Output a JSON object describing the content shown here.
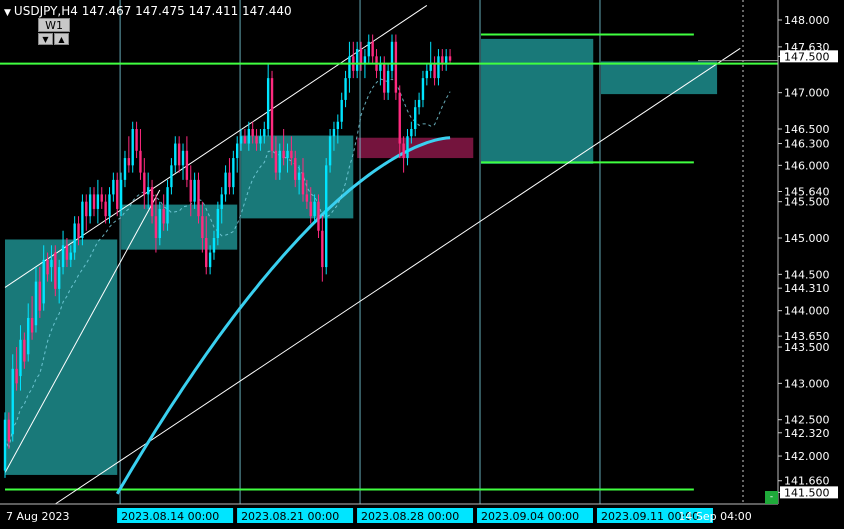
{
  "header": {
    "symbol": "USDJPY,H4",
    "ohlc": "147.467 147.475 147.411 147.440",
    "timeframe_label": "W1",
    "btn_down": "▼",
    "btn_up": "▲",
    "corner_btn": "-"
  },
  "colors": {
    "background": "#000000",
    "bull": "#00e5ff",
    "bear": "#ff2a7f",
    "zone_teal": "#1a7f7f",
    "zone_maroon": "#7a1540",
    "ma_thick": "#3ad0f0",
    "level_green": "#40ff40",
    "current_line": "#40ff40",
    "vgrid": "#7fd6e6"
  },
  "chart_data": {
    "type": "candlestick",
    "symbol": "USDJPY",
    "period": "H4",
    "ylim": [
      141.34,
      148.22
    ],
    "price_ticks": [
      148.0,
      147.63,
      147.5,
      147.0,
      146.5,
      146.3,
      146.0,
      145.64,
      145.5,
      145.0,
      144.5,
      144.31,
      144.0,
      143.65,
      143.5,
      143.0,
      142.5,
      142.32,
      142.0,
      141.66,
      141.5
    ],
    "price_tick_labels": [
      "148.000",
      "147.630",
      "147.500",
      "147.000",
      "146.500",
      "146.300",
      "146.000",
      "145.640",
      "145.500",
      "145.000",
      "144.500",
      "144.310",
      "144.000",
      "143.650",
      "143.500",
      "143.000",
      "142.500",
      "142.320",
      "142.000",
      "141.660",
      "141.500"
    ],
    "time_labels": [
      {
        "label": "7 Aug 2023",
        "bar": 0,
        "highlight": false
      },
      {
        "label": "2023.08.14 00:00",
        "bar": 30,
        "highlight": true
      },
      {
        "label": "2023.08.21 00:00",
        "bar": 61,
        "highlight": true
      },
      {
        "label": "2023.08.28 00:00",
        "bar": 92,
        "highlight": true
      },
      {
        "label": "2023.09.04 00:00",
        "bar": 123,
        "highlight": true
      },
      {
        "label": "2023.09.11 00:00",
        "bar": 154,
        "highlight": true
      },
      {
        "label": "14 Sep 04:00",
        "bar": 174,
        "highlight": false
      }
    ],
    "last_price": 147.44,
    "current_line_price": 147.4,
    "horizontal_levels": [
      {
        "price": 147.8,
        "from_bar": 123,
        "to_bar": 178
      },
      {
        "price": 146.04,
        "from_bar": 123,
        "to_bar": 178
      },
      {
        "price": 141.54,
        "from_bar": 0,
        "to_bar": 178
      }
    ],
    "zones": [
      {
        "from_bar": 0,
        "to_bar": 29,
        "high": 144.98,
        "low": 141.74,
        "color": "teal"
      },
      {
        "from_bar": 30,
        "to_bar": 60,
        "high": 145.46,
        "low": 144.84,
        "color": "teal"
      },
      {
        "from_bar": 61,
        "to_bar": 90,
        "high": 146.41,
        "low": 145.27,
        "color": "teal"
      },
      {
        "from_bar": 91,
        "to_bar": 121,
        "high": 146.38,
        "low": 146.1,
        "color": "maroon"
      },
      {
        "from_bar": 123,
        "to_bar": 152,
        "high": 147.74,
        "low": 146.02,
        "color": "teal"
      },
      {
        "from_bar": 154,
        "to_bar": 184,
        "high": 147.43,
        "low": 146.98,
        "color": "teal"
      }
    ],
    "trendlines": [
      {
        "x1": 0,
        "y1": 144.32,
        "x2": 109,
        "y2": 148.2
      },
      {
        "x1": 0,
        "y1": 141.77,
        "x2": 40,
        "y2": 145.66
      },
      {
        "x1": 13,
        "y1": 141.34,
        "x2": 190,
        "y2": 147.61
      }
    ],
    "moving_average_thick": {
      "from_bar": 29,
      "start": 141.48,
      "end": 146.38
    },
    "ohlc": [
      [
        141.8,
        142.6,
        141.7,
        142.5
      ],
      [
        142.5,
        142.6,
        142.1,
        142.2
      ],
      [
        142.3,
        143.4,
        142.2,
        143.2
      ],
      [
        143.2,
        143.5,
        142.9,
        143.0
      ],
      [
        143.1,
        143.8,
        142.9,
        143.6
      ],
      [
        143.6,
        143.7,
        143.2,
        143.3
      ],
      [
        143.4,
        144.1,
        143.3,
        143.9
      ],
      [
        143.9,
        144.2,
        143.6,
        143.7
      ],
      [
        143.8,
        144.6,
        143.7,
        144.4
      ],
      [
        144.4,
        144.6,
        143.9,
        144.0
      ],
      [
        144.1,
        144.9,
        144.0,
        144.7
      ],
      [
        144.7,
        144.8,
        144.4,
        144.5
      ],
      [
        144.6,
        144.9,
        144.4,
        144.7
      ],
      [
        144.8,
        144.9,
        144.2,
        144.3
      ],
      [
        144.3,
        144.7,
        144.1,
        144.6
      ],
      [
        144.6,
        145.1,
        144.5,
        144.9
      ],
      [
        144.9,
        145.0,
        144.6,
        144.7
      ],
      [
        144.7,
        144.9,
        144.6,
        144.8
      ],
      [
        144.8,
        145.3,
        144.7,
        145.2
      ],
      [
        145.2,
        145.3,
        144.9,
        145.0
      ],
      [
        145.0,
        145.6,
        144.9,
        145.5
      ],
      [
        145.5,
        145.6,
        145.1,
        145.3
      ],
      [
        145.3,
        145.7,
        145.2,
        145.6
      ],
      [
        145.6,
        145.7,
        145.3,
        145.4
      ],
      [
        145.4,
        145.8,
        145.2,
        145.6
      ],
      [
        145.6,
        145.7,
        145.4,
        145.5
      ],
      [
        145.5,
        145.6,
        145.2,
        145.3
      ],
      [
        145.3,
        145.7,
        145.2,
        145.6
      ],
      [
        145.6,
        145.9,
        145.5,
        145.8
      ],
      [
        145.8,
        145.9,
        145.3,
        145.4
      ],
      [
        145.4,
        145.9,
        145.3,
        145.8
      ],
      [
        145.8,
        146.2,
        145.7,
        146.1
      ],
      [
        146.1,
        146.4,
        145.9,
        146.0
      ],
      [
        146.0,
        146.6,
        145.9,
        146.5
      ],
      [
        146.5,
        146.6,
        146.1,
        146.2
      ],
      [
        146.2,
        146.5,
        145.8,
        145.9
      ],
      [
        145.9,
        146.1,
        145.4,
        145.6
      ],
      [
        145.6,
        145.9,
        145.4,
        145.7
      ],
      [
        145.7,
        145.8,
        145.2,
        145.3
      ],
      [
        145.3,
        145.6,
        144.8,
        145.0
      ],
      [
        145.0,
        145.5,
        144.9,
        145.4
      ],
      [
        145.4,
        145.6,
        145.1,
        145.2
      ],
      [
        145.2,
        145.8,
        145.1,
        145.7
      ],
      [
        145.7,
        146.1,
        145.6,
        146.0
      ],
      [
        146.0,
        146.4,
        145.9,
        146.3
      ],
      [
        146.3,
        146.4,
        145.9,
        146.0
      ],
      [
        146.0,
        146.3,
        145.8,
        146.2
      ],
      [
        146.2,
        146.4,
        145.7,
        145.8
      ],
      [
        145.8,
        146.0,
        145.3,
        145.5
      ],
      [
        145.5,
        145.9,
        145.4,
        145.8
      ],
      [
        145.8,
        145.9,
        145.2,
        145.3
      ],
      [
        145.3,
        145.5,
        144.8,
        145.0
      ],
      [
        145.0,
        145.3,
        144.5,
        144.6
      ],
      [
        144.6,
        144.9,
        144.5,
        144.8
      ],
      [
        144.8,
        145.1,
        144.7,
        145.0
      ],
      [
        145.0,
        145.5,
        144.9,
        145.4
      ],
      [
        145.4,
        145.7,
        145.2,
        145.6
      ],
      [
        145.6,
        146.0,
        145.5,
        145.9
      ],
      [
        145.9,
        146.1,
        145.6,
        145.7
      ],
      [
        145.7,
        146.2,
        145.6,
        146.1
      ],
      [
        146.1,
        146.4,
        145.9,
        146.3
      ],
      [
        146.3,
        146.5,
        146.2,
        146.4
      ],
      [
        146.4,
        146.5,
        146.3,
        146.3
      ],
      [
        146.3,
        146.6,
        146.2,
        146.5
      ],
      [
        146.5,
        146.6,
        146.3,
        146.4
      ],
      [
        146.4,
        146.5,
        146.2,
        146.3
      ],
      [
        146.3,
        146.5,
        146.2,
        146.4
      ],
      [
        146.4,
        146.6,
        146.3,
        146.5
      ],
      [
        146.5,
        147.4,
        146.4,
        147.2
      ],
      [
        147.2,
        147.3,
        146.1,
        146.2
      ],
      [
        146.2,
        146.4,
        145.8,
        145.9
      ],
      [
        145.9,
        146.3,
        145.8,
        146.2
      ],
      [
        146.2,
        146.5,
        146.0,
        146.1
      ],
      [
        146.1,
        146.3,
        145.9,
        146.2
      ],
      [
        146.2,
        146.4,
        146.0,
        146.1
      ],
      [
        146.1,
        146.2,
        145.7,
        145.8
      ],
      [
        145.8,
        146.0,
        145.6,
        145.9
      ],
      [
        145.9,
        146.1,
        145.5,
        145.6
      ],
      [
        145.6,
        145.8,
        145.4,
        145.5
      ],
      [
        145.5,
        145.7,
        145.2,
        145.3
      ],
      [
        145.3,
        145.6,
        145.2,
        145.5
      ],
      [
        145.5,
        145.6,
        145.0,
        145.1
      ],
      [
        145.1,
        145.3,
        144.4,
        144.6
      ],
      [
        144.6,
        146.1,
        144.5,
        146.0
      ],
      [
        146.0,
        146.5,
        145.9,
        146.4
      ],
      [
        146.4,
        146.6,
        146.2,
        146.5
      ],
      [
        146.5,
        146.7,
        146.3,
        146.6
      ],
      [
        146.6,
        147.0,
        146.5,
        146.9
      ],
      [
        146.9,
        147.3,
        146.8,
        147.2
      ],
      [
        147.2,
        147.7,
        147.0,
        147.5
      ],
      [
        147.5,
        147.7,
        147.2,
        147.3
      ],
      [
        147.3,
        147.7,
        147.2,
        147.6
      ],
      [
        147.6,
        147.7,
        147.3,
        147.4
      ],
      [
        147.4,
        147.6,
        147.2,
        147.5
      ],
      [
        147.5,
        147.8,
        147.4,
        147.7
      ],
      [
        147.7,
        147.8,
        147.4,
        147.5
      ],
      [
        147.5,
        147.6,
        147.2,
        147.3
      ],
      [
        147.3,
        147.5,
        147.1,
        147.4
      ],
      [
        147.4,
        147.5,
        146.9,
        147.0
      ],
      [
        147.0,
        147.4,
        146.9,
        147.3
      ],
      [
        147.3,
        147.8,
        147.2,
        147.7
      ],
      [
        147.7,
        147.8,
        146.9,
        147.0
      ],
      [
        147.0,
        147.1,
        146.1,
        146.3
      ],
      [
        146.3,
        146.4,
        145.9,
        146.1
      ],
      [
        146.1,
        146.5,
        146.0,
        146.4
      ],
      [
        146.4,
        146.6,
        146.3,
        146.5
      ],
      [
        146.5,
        146.9,
        146.4,
        146.8
      ],
      [
        146.8,
        147.0,
        146.7,
        146.9
      ],
      [
        146.9,
        147.3,
        146.8,
        147.2
      ],
      [
        147.2,
        147.4,
        147.1,
        147.3
      ],
      [
        147.3,
        147.7,
        147.2,
        147.4
      ],
      [
        147.4,
        147.5,
        147.1,
        147.2
      ],
      [
        147.2,
        147.6,
        147.1,
        147.5
      ],
      [
        147.5,
        147.6,
        147.3,
        147.4
      ],
      [
        147.4,
        147.6,
        147.3,
        147.5
      ],
      [
        147.5,
        147.6,
        147.4,
        147.44
      ]
    ]
  }
}
